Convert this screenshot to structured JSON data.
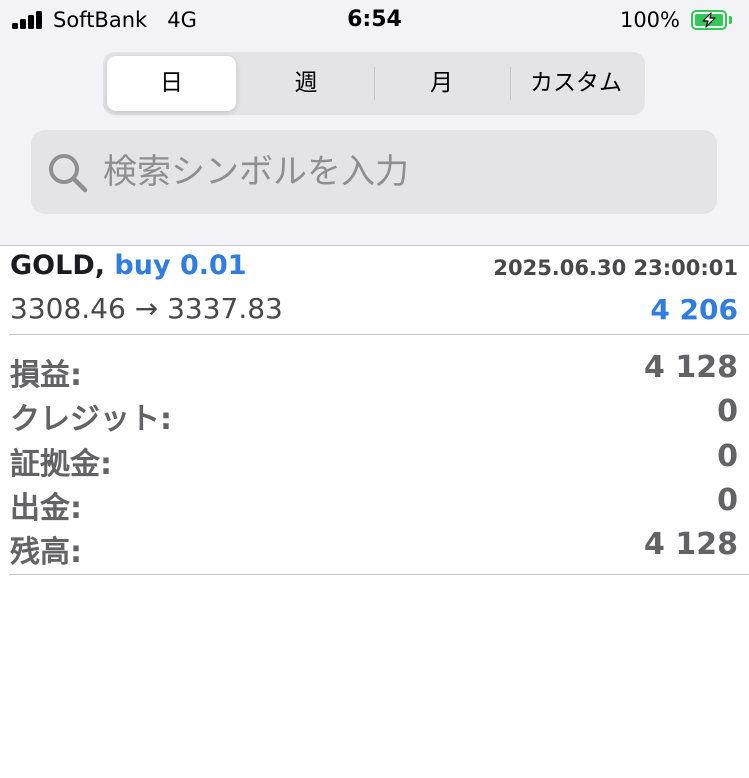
{
  "status_bar": {
    "carrier": "SoftBank",
    "network": "4G",
    "time": "6:54",
    "battery_percent": "100%",
    "battery_color": "#34c759"
  },
  "period_tabs": {
    "selected": "日",
    "items": [
      {
        "label": "日"
      },
      {
        "label": "週"
      },
      {
        "label": "月"
      },
      {
        "label": "カスタム"
      }
    ]
  },
  "search": {
    "placeholder": "検索シンボルを入力",
    "value": "",
    "icon": "search-icon"
  },
  "trade": {
    "symbol": "GOLD,",
    "side_volume": "buy 0.01",
    "datetime": "2025.06.30 23:00:01",
    "open_price": "3308.46",
    "arrow": "→",
    "close_price": "3337.83",
    "profit": "4 206",
    "accent_color": "#2f7de1"
  },
  "summary": [
    {
      "label": "損益:",
      "value": "4 128"
    },
    {
      "label": "クレジット:",
      "value": "0"
    },
    {
      "label": "証拠金:",
      "value": "0"
    },
    {
      "label": "出金:",
      "value": "0"
    },
    {
      "label": "残高:",
      "value": "4 128"
    }
  ]
}
